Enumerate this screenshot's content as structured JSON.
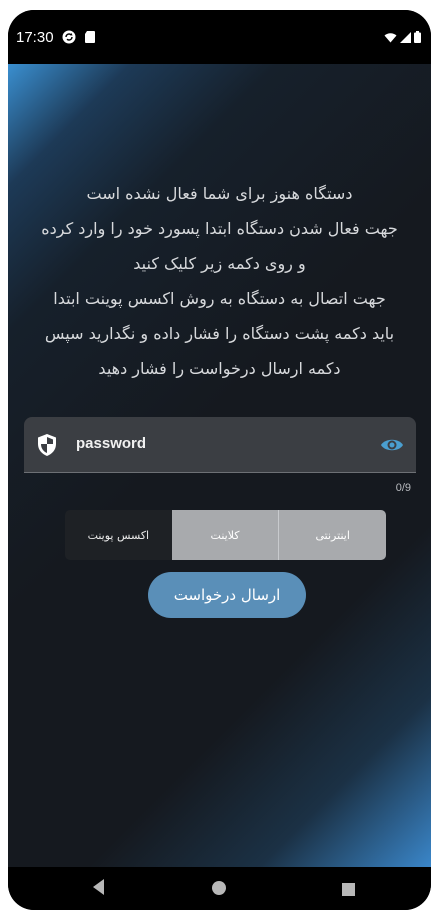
{
  "status_bar": {
    "time": "17:30",
    "icons": [
      "sync-icon",
      "sd-card-icon",
      "wifi-icon",
      "signal-icon",
      "battery-icon"
    ]
  },
  "message": {
    "lines": [
      "دستگاه هنوز برای شما فعال نشده است",
      "جهت فعال شدن دستگاه ابتدا پسورد خود را وارد کرده",
      "و روی دکمه زیر کلیک کنید",
      "جهت اتصال به دستگاه به روش اکسس پوینت ابتدا",
      "باید دکمه پشت دستگاه را فشار داده و نگدارید سپس",
      "دکمه ارسال درخواست را فشار دهید"
    ]
  },
  "password_field": {
    "value": "password",
    "counter": "0/9",
    "leading_icon": "shield-icon",
    "trailing_icon": "eye-icon"
  },
  "mode_selector": {
    "options": [
      "اکسس پوینت",
      "کلاینت",
      "اینترنتی"
    ],
    "selected": "اکسس پوینت"
  },
  "submit_button": {
    "label": "ارسال درخواست"
  },
  "nav_bar": {
    "icons": [
      "back-icon",
      "home-icon",
      "recents-icon"
    ]
  },
  "colors": {
    "background": "#15191f",
    "accent_gradient": "#3a8fd0",
    "field_bg": "#3b3e43",
    "segment_selected": "#1e2125",
    "segment_unselected": "#a8aaad",
    "button": "#5a8fb8",
    "eye_icon": "#4a9fd0"
  }
}
